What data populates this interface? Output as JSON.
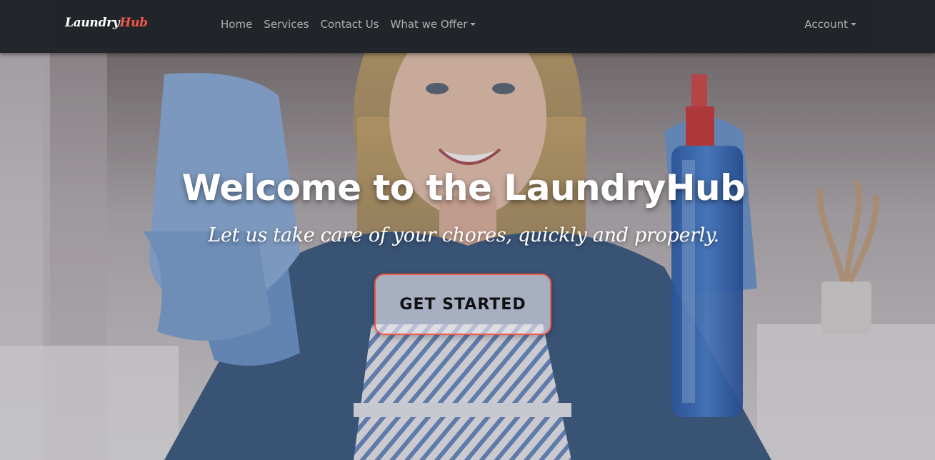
{
  "navbar": {
    "brand": {
      "part1": "Laundry",
      "part2": "Hub"
    },
    "links": [
      {
        "label": "Home"
      },
      {
        "label": "Services"
      },
      {
        "label": "Contact Us"
      },
      {
        "label": "What we Offer"
      }
    ],
    "account_label": "Account"
  },
  "hero": {
    "title": "Welcome to the LaundryHub",
    "subtitle": "Let us take care of your chores, quickly and properly.",
    "cta_label": "GET STARTED"
  },
  "colors": {
    "navbar_bg": "#212529",
    "accent": "#f0584a",
    "text_light": "#ffffff",
    "nav_text": "rgba(255,255,255,0.62)"
  }
}
